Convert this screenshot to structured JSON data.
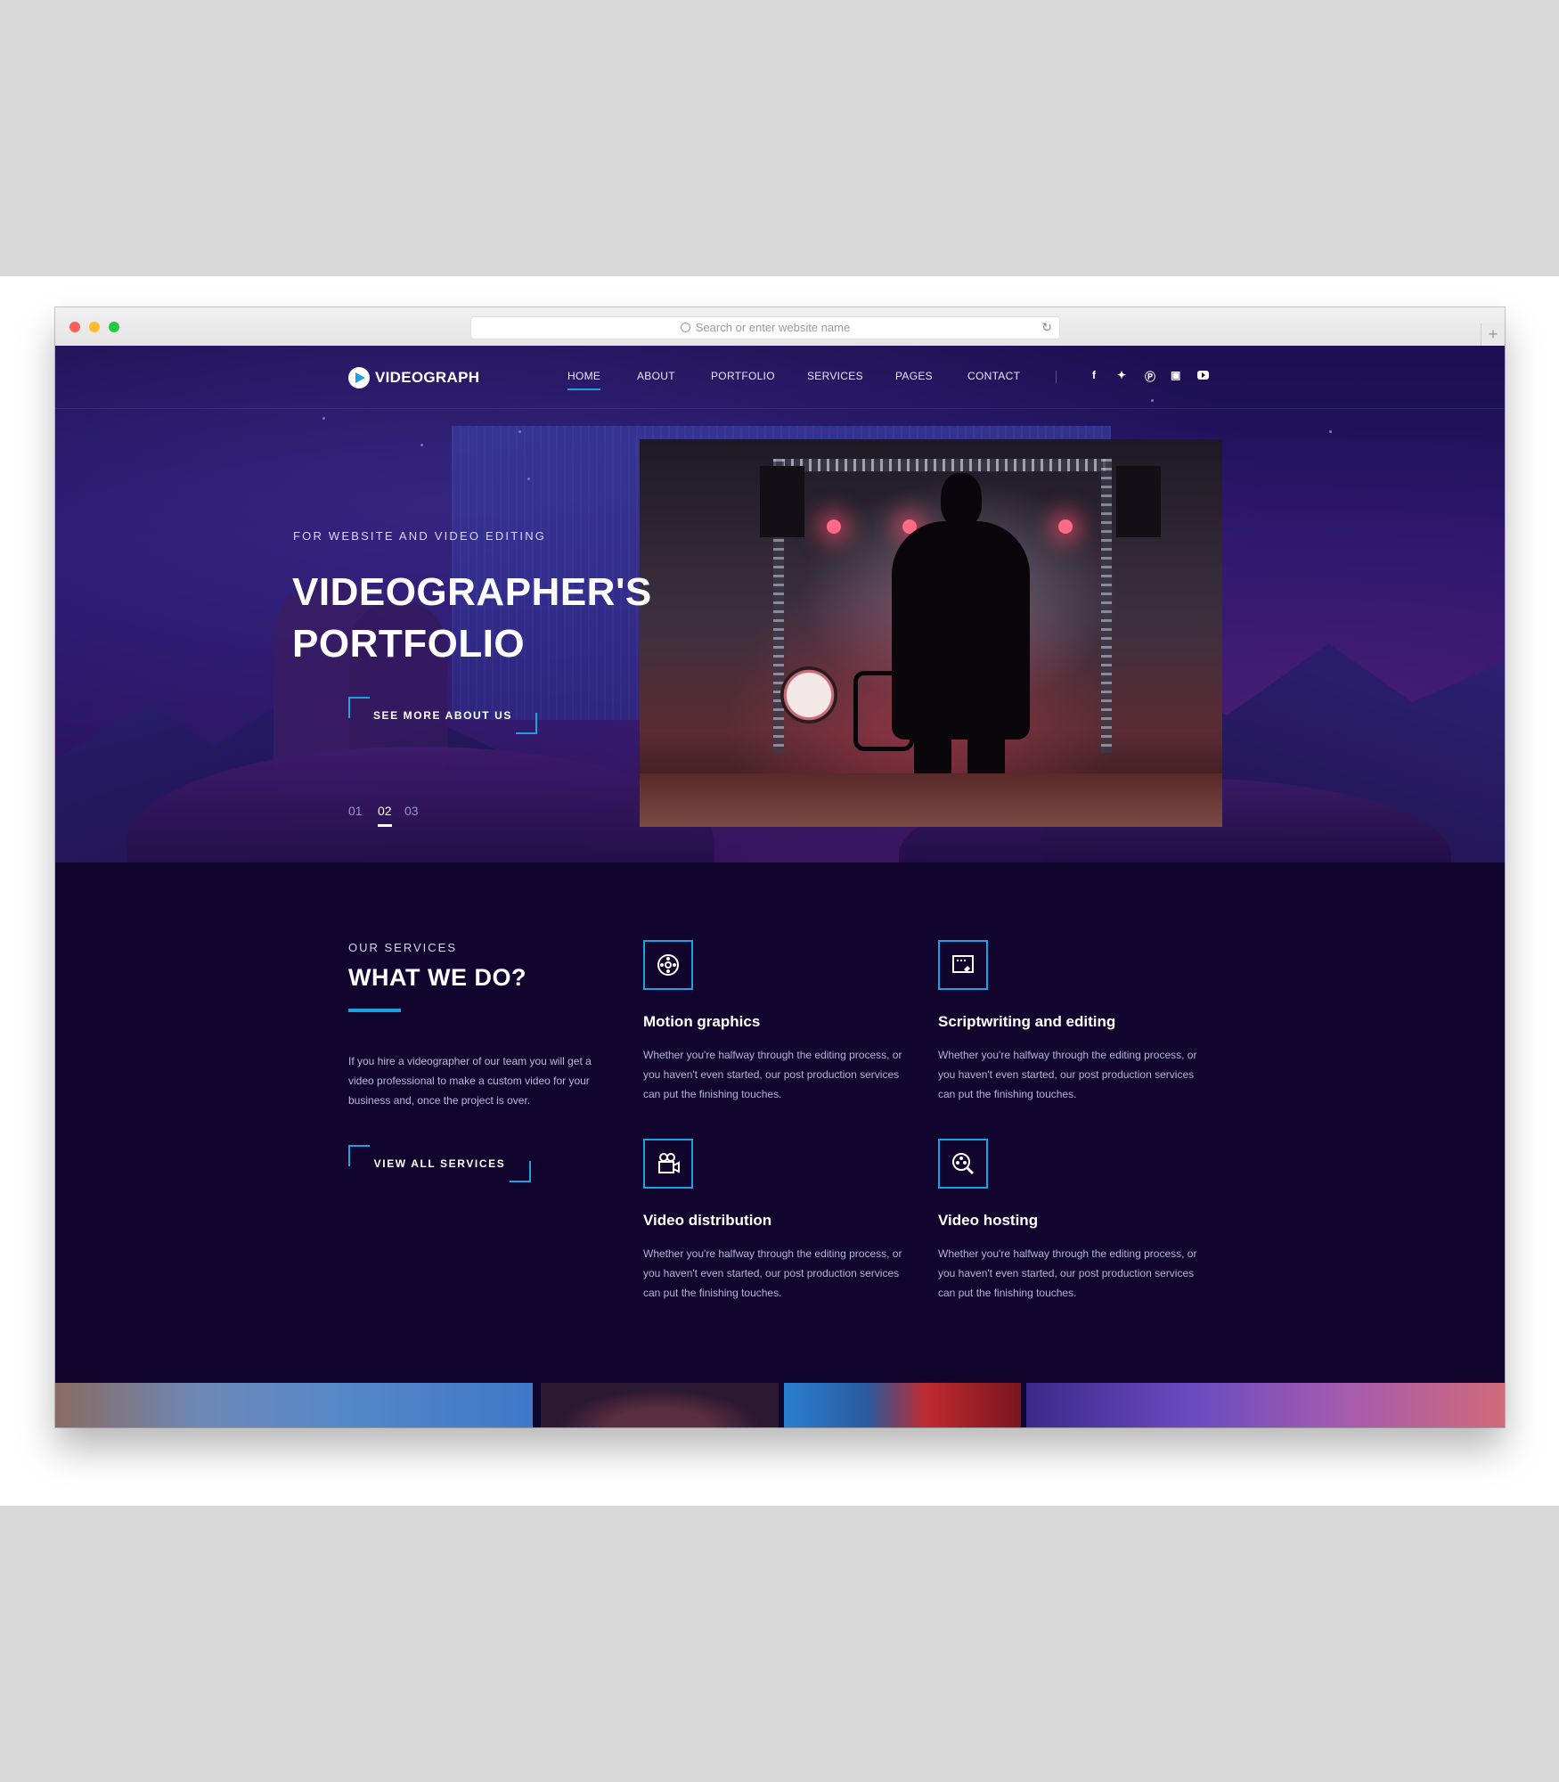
{
  "browser": {
    "url_placeholder": "Search or enter website name"
  },
  "nav": {
    "logo_text": "VIDEOGRAPH",
    "items": [
      {
        "label": "HOME",
        "active": true
      },
      {
        "label": "ABOUT",
        "active": false
      },
      {
        "label": "PORTFOLIO",
        "active": false
      },
      {
        "label": "SERVICES",
        "active": false
      },
      {
        "label": "PAGES",
        "active": false
      },
      {
        "label": "CONTACT",
        "active": false
      }
    ],
    "social_icons": [
      "facebook-icon",
      "twitter-icon",
      "pinterest-icon",
      "instagram-icon",
      "youtube-icon"
    ]
  },
  "hero": {
    "subtitle": "FOR WEBSITE AND VIDEO EDITING",
    "title_line1": "VIDEOGRAPHER'S",
    "title_line2": "PORTFOLIO",
    "button_label": "SEE MORE ABOUT US",
    "slides": [
      "01",
      "02",
      "03"
    ],
    "active_slide": "02"
  },
  "services": {
    "kicker": "OUR SERVICES",
    "title": "WHAT WE DO?",
    "intro": "If you hire a videographer of our team you will get a video professional to make a custom video for your business and, once the project is over.",
    "button_label": "VIEW ALL SERVICES",
    "cards": [
      {
        "title": "Motion graphics",
        "description": "Whether you're halfway through the editing process, or you haven't even started, our post production services can put the finishing touches.",
        "icon": "film-reel-icon"
      },
      {
        "title": "Scriptwriting and editing",
        "description": "Whether you're halfway through the editing process, or you haven't even started, our post production services can put the finishing touches.",
        "icon": "script-edit-icon"
      },
      {
        "title": "Video distribution",
        "description": "Whether you're halfway through the editing process, or you haven't even started, our post production services can put the finishing touches.",
        "icon": "video-camera-icon"
      },
      {
        "title": "Video hosting",
        "description": "Whether you're halfway through the editing process, or you haven't even started, our post production services can put the finishing touches.",
        "icon": "reel-search-icon"
      }
    ]
  },
  "colors": {
    "accent": "#1aa3e0",
    "page_bg": "#11052e",
    "hero_bg": "#24166a"
  }
}
